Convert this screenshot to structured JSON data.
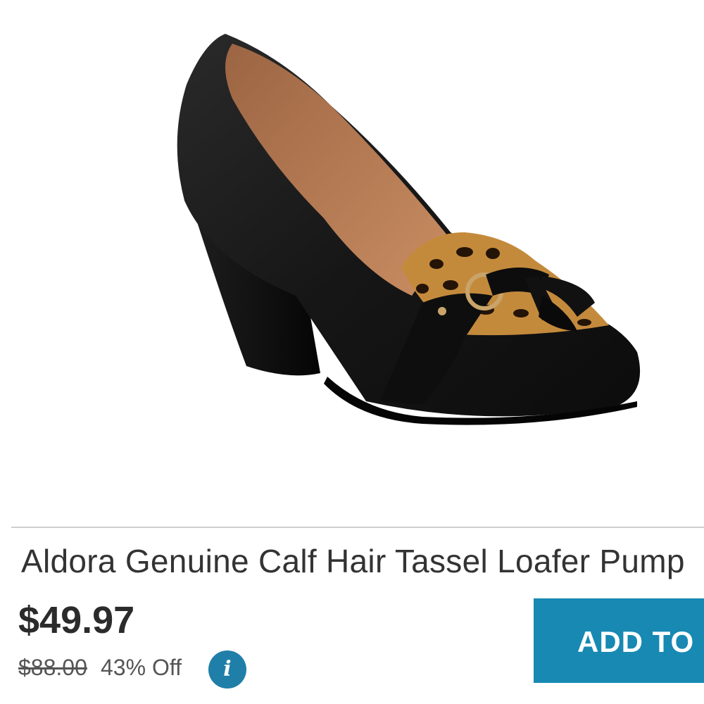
{
  "product": {
    "title": "Aldora Genuine Calf Hair Tassel Loafer Pump",
    "price": "$49.97",
    "original_price": "$88.00",
    "discount": "43% Off",
    "info_icon_glyph": "i",
    "add_to_cart_label": "ADD TO CART"
  },
  "colors": {
    "accent": "#1789b3",
    "info_badge": "#1f7fa8",
    "text": "#333333",
    "divider": "#cfcfcf"
  }
}
